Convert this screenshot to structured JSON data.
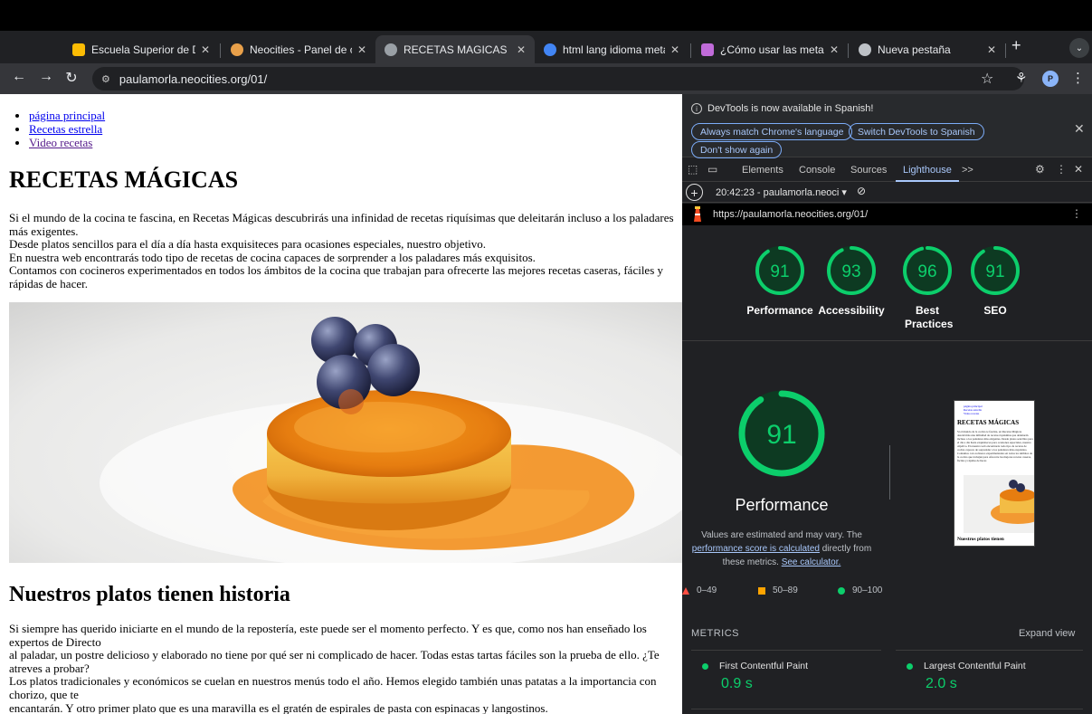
{
  "browser": {
    "tabs": [
      {
        "title": "Escuela Superior de Diseño",
        "icon_color": "#fbbc04"
      },
      {
        "title": "Neocities - Panel de control",
        "icon_color": "#e8a04a"
      },
      {
        "title": "RECETAS MAGICAS",
        "icon_color": "#9aa0a6",
        "active": true
      },
      {
        "title": "html lang idioma meta - Google",
        "icon_color": "#4285f4"
      },
      {
        "title": "¿Cómo usar las meta etiquetas?",
        "icon_color": "#c06bd9"
      },
      {
        "title": "Nueva pestaña",
        "icon_color": "#bdc1c6"
      }
    ],
    "url": "paulamorla.neocities.org/01/",
    "profile_initial": "P"
  },
  "page": {
    "nav_links": [
      "página principal",
      "Recetas estrella",
      "Video recetas"
    ],
    "title": "RECETAS MÁGICAS",
    "intro": [
      "Si el mundo de la cocina te fascina, en Recetas Mágicas descubrirás una infinidad de recetas riquísimas que deleitarán incluso a los paladares más exigentes.",
      "Desde platos sencillos para el día a día hasta exquisiteces para ocasiones especiales, nuestro objetivo.",
      "En nuestra web encontrarás todo tipo de recetas de cocina capaces de sorprender a los paladares más exquisitos.",
      "Contamos con cocineros experimentados en todos los ámbitos de la cocina que trabajan para ofrecerte las mejores recetas caseras, fáciles y rápidas de hacer."
    ],
    "subtitle": "Nuestros platos tienen historia",
    "history": [
      "Si siempre has querido iniciarte en el mundo de la repostería, este puede ser el momento perfecto. Y es que, como nos han enseñado los expertos de Directo",
      "al paladar, un postre delicioso y elaborado no tiene por qué ser ni complicado de hacer. Todas estas tartas fáciles son la prueba de ello. ¿Te atreves a probar?",
      "Los platos tradicionales y económicos se cuelan en nuestros menús todo el año. Hemos elegido también unas patatas a la importancia con chorizo, que te",
      "encantarán. Y otro primer plato que es una maravilla es el gratén de espirales de pasta con espinacas y langostinos."
    ]
  },
  "devtools": {
    "info_message": "DevTools is now available in Spanish!",
    "info_buttons": [
      "Always match Chrome's language",
      "Switch DevTools to Spanish",
      "Don't show again"
    ],
    "tabs": [
      "Elements",
      "Console",
      "Sources",
      "Lighthouse"
    ],
    "more_tabs": ">>",
    "report_label": "20:42:23 - paulamorla.neoci",
    "report_url": "https://paulamorla.neocities.org/01/",
    "scores": [
      {
        "label": "Performance",
        "value": 91
      },
      {
        "label": "Accessibility",
        "value": 93
      },
      {
        "label": "Best Practices",
        "value": 96
      },
      {
        "label": "SEO",
        "value": 91
      }
    ],
    "detail": {
      "value": 91,
      "label": "Performance",
      "desc_pre": "Values are estimated and may vary. The",
      "desc_link": "performance score is calculated",
      "desc_mid": "directly from these metrics.",
      "desc_link2": "See calculator."
    },
    "thumbnail": {
      "links": [
        "página principal",
        "Recetas estrella",
        "Video recetas"
      ],
      "title": "RECETAS MÁGICAS",
      "text": "Si el mundo de la cocina te fascina, en Recetas Mágicas descubrirás una infinidad de recetas riquísimas que deleitarán incluso a los paladares más exigentes. Desde platos sencillos para el día a día hasta exquisiteces para ocasiones especiales, nuestro objetivo. En nuestra web encontrarás todo tipo de recetas de cocina capaces de sorprender a los paladares más exquisitos. Contamos con cocineros experimentados en todos los ámbitos de la cocina que trabajan para ofrecerte las mejores recetas caseras, fáciles y rápidas de hacer.",
      "subtitle": "Nuestros platos tienen"
    },
    "legend": [
      {
        "range": "0–49",
        "color": "#ff4e42"
      },
      {
        "range": "50–89",
        "color": "#ffa400"
      },
      {
        "range": "90–100",
        "color": "#0cce6b"
      }
    ],
    "metrics_title": "METRICS",
    "expand_view": "Expand view",
    "metrics": [
      {
        "name": "First Contentful Paint",
        "value": "0.9 s"
      },
      {
        "name": "Largest Contentful Paint",
        "value": "2.0 s"
      }
    ],
    "colors": {
      "good": "#0cce6b",
      "good_bg": "#0d3a22",
      "link": "#a8c7fa"
    }
  }
}
